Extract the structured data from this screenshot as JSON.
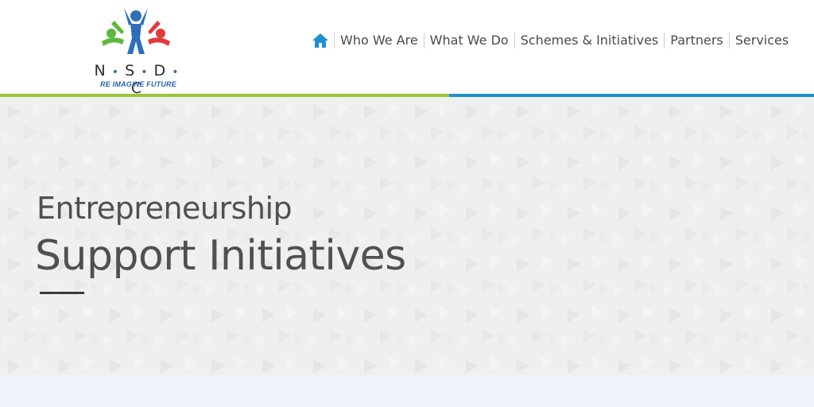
{
  "logo": {
    "letters": [
      "N",
      "S",
      "D",
      "C"
    ],
    "tagline": "RE IMAGINE FUTURE",
    "colors": {
      "blue": "#2f6fb8",
      "green": "#5cb83a",
      "red": "#e23a3a"
    }
  },
  "nav": {
    "home_icon": "home-icon",
    "items": [
      {
        "label": "Who We Are"
      },
      {
        "label": "What We Do"
      },
      {
        "label": "Schemes & Initiatives"
      },
      {
        "label": "Partners"
      },
      {
        "label": "Services"
      }
    ]
  },
  "accent_colors": {
    "green": "#9cc43a",
    "blue": "#1d8fd0"
  },
  "hero": {
    "title_line_1": "Entrepreneurship",
    "title_line_2": "Support Initiatives"
  }
}
